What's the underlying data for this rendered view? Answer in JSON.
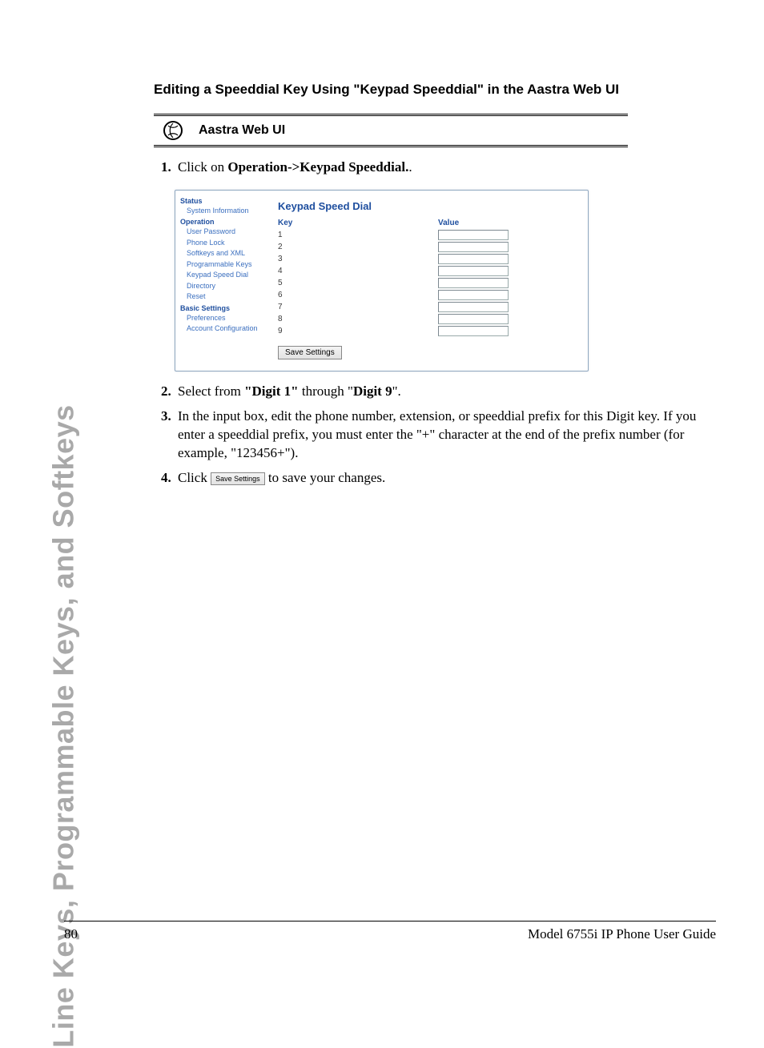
{
  "sidebar_tab": "Line Keys, Programmable Keys, and Softkeys",
  "section_title": "Editing a Speeddial Key Using \"Keypad Speeddial\" in the Aastra Web UI",
  "ui_box_title": "Aastra Web UI",
  "steps": {
    "s1_pre": "Click on ",
    "s1_bold": "Operation->Keypad Speeddial.",
    "s1_post": "."
  },
  "screenshot": {
    "nav": {
      "status_head": "Status",
      "status_item": "System Information",
      "operation_head": "Operation",
      "operation_items": [
        "User Password",
        "Phone Lock",
        "Softkeys and XML",
        "Programmable Keys",
        "Keypad Speed Dial",
        "Directory",
        "Reset"
      ],
      "basic_head": "Basic Settings",
      "basic_items": [
        "Preferences",
        "Account Configuration"
      ]
    },
    "main": {
      "title": "Keypad Speed Dial",
      "col_key": "Key",
      "col_value": "Value",
      "rows": [
        "1",
        "2",
        "3",
        "4",
        "5",
        "6",
        "7",
        "8",
        "9"
      ],
      "save_button": "Save Settings"
    }
  },
  "steps_lower": {
    "s2_pre": "Select from ",
    "s2_b1": "\"Digit 1\"",
    "s2_mid": " through \"",
    "s2_b2": "Digit 9",
    "s2_post": "\".",
    "s3": "In the input box, edit the phone number, extension, or speeddial prefix for this Digit key. If you enter a speeddial prefix, you must enter the \"+\" character at the end of the prefix number (for example, \"123456+\").",
    "s4_pre": "Click ",
    "s4_btn": "Save Settings",
    "s4_post": " to save your changes."
  },
  "footer": {
    "page": "80",
    "book": "Model 6755i IP Phone User Guide"
  }
}
